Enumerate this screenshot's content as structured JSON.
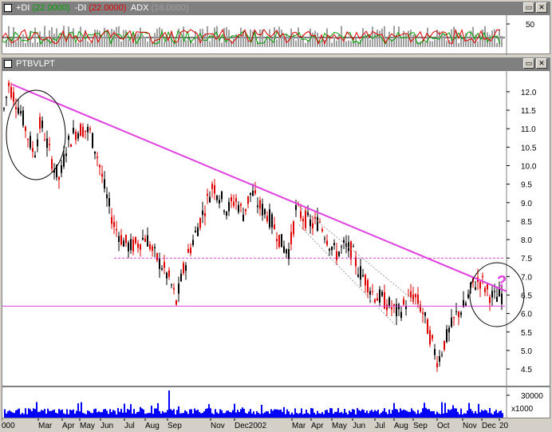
{
  "indicator_panel": {
    "title_di_plus": "+DI",
    "di_plus_value": "(22.0000)",
    "title_di_minus": "-DI",
    "di_minus_value": "(22.0000)",
    "title_adx": "ADX",
    "adx_value": "(18.0000)",
    "right_tick": "50"
  },
  "price_panel": {
    "title": "PTBVLPT"
  },
  "volume_panel": {
    "tick_top": "30000",
    "tick_mid": "0",
    "scale_label": "x1000"
  },
  "colors": {
    "trendline": "#e040e0",
    "support": "#e040e0",
    "up_candle": "#000000",
    "down_candle": "#e00000",
    "volume": "#0000ff",
    "question_mark": "#e040e0"
  },
  "chart_data": {
    "type": "candlestick",
    "y_ticks": [
      "12.0",
      "11.5",
      "11.0",
      "10.5",
      "10.0",
      "9.5",
      "9.0",
      "8.5",
      "8.0",
      "7.5",
      "7.0",
      "6.5",
      "6.0",
      "5.5",
      "5.0",
      "4.5"
    ],
    "ylim": [
      4.3,
      12.4
    ],
    "x_labels": [
      "000",
      "Mar",
      "Apr",
      "May",
      "Jun",
      "Jul",
      "Aug",
      "Sep",
      "Nov",
      "Dec2002",
      "Mar",
      "Apr",
      "May",
      "Jun",
      "Jul",
      "Aug",
      "Sep",
      "Oct",
      "Nov",
      "Dec",
      "20"
    ],
    "price_path": [
      [
        0,
        11.3
      ],
      [
        8,
        12.2
      ],
      [
        16,
        11.8
      ],
      [
        24,
        11.4
      ],
      [
        32,
        10.8
      ],
      [
        40,
        10.3
      ],
      [
        48,
        11.2
      ],
      [
        56,
        10.6
      ],
      [
        64,
        10.0
      ],
      [
        72,
        9.6
      ],
      [
        80,
        10.5
      ],
      [
        90,
        10.9
      ],
      [
        100,
        11.0
      ],
      [
        110,
        10.9
      ],
      [
        120,
        10.2
      ],
      [
        130,
        9.2
      ],
      [
        140,
        8.4
      ],
      [
        150,
        8.0
      ],
      [
        160,
        7.8
      ],
      [
        170,
        7.9
      ],
      [
        180,
        8.1
      ],
      [
        190,
        7.6
      ],
      [
        200,
        7.3
      ],
      [
        210,
        6.9
      ],
      [
        218,
        6.3
      ],
      [
        226,
        7.1
      ],
      [
        236,
        7.8
      ],
      [
        246,
        8.4
      ],
      [
        256,
        9.0
      ],
      [
        264,
        9.5
      ],
      [
        272,
        9.2
      ],
      [
        282,
        8.8
      ],
      [
        292,
        9.1
      ],
      [
        302,
        8.7
      ],
      [
        312,
        9.3
      ],
      [
        322,
        8.9
      ],
      [
        332,
        8.7
      ],
      [
        342,
        8.3
      ],
      [
        352,
        7.8
      ],
      [
        360,
        7.7
      ],
      [
        368,
        8.8
      ],
      [
        378,
        8.6
      ],
      [
        388,
        8.4
      ],
      [
        398,
        8.5
      ],
      [
        408,
        8.0
      ],
      [
        418,
        7.6
      ],
      [
        428,
        7.8
      ],
      [
        438,
        7.7
      ],
      [
        446,
        7.2
      ],
      [
        456,
        6.9
      ],
      [
        466,
        6.5
      ],
      [
        476,
        6.4
      ],
      [
        486,
        6.2
      ],
      [
        496,
        6.0
      ],
      [
        506,
        6.3
      ],
      [
        516,
        6.5
      ],
      [
        526,
        6.1
      ],
      [
        536,
        5.4
      ],
      [
        546,
        4.7
      ],
      [
        554,
        5.2
      ],
      [
        562,
        5.6
      ],
      [
        570,
        6.0
      ],
      [
        580,
        6.2
      ],
      [
        590,
        6.8
      ],
      [
        600,
        6.9
      ],
      [
        608,
        6.6
      ],
      [
        616,
        6.4
      ],
      [
        624,
        6.5
      ]
    ],
    "trendline": {
      "from": [
        12,
        12.2
      ],
      "to": [
        632,
        6.6
      ]
    },
    "support_line": 6.2,
    "resistance_line": 7.5,
    "annotations": [
      "?"
    ]
  }
}
